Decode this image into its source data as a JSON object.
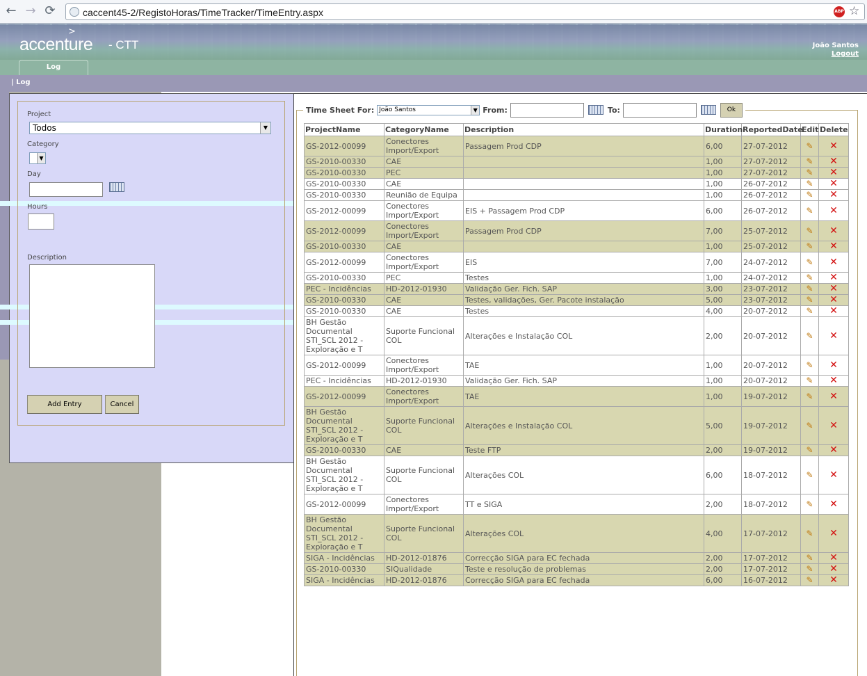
{
  "browser": {
    "url": "caccent45-2/RegistoHoras/TimeTracker/TimeEntry.aspx",
    "adblock_badge": "ABP"
  },
  "header": {
    "logo": "accenture",
    "logo_mark": ">",
    "suffix": "- CTT",
    "user": "João Santos",
    "logout": "Logout"
  },
  "tabs": [
    {
      "label": "Log"
    }
  ],
  "breadcrumb": "| Log",
  "form": {
    "project_label": "Project",
    "project_value": "Todos",
    "category_label": "Category",
    "day_label": "Day",
    "hours_label": "Hours",
    "description_label": "Description",
    "add_button": "Add Entry",
    "cancel_button": "Cancel"
  },
  "timesheet": {
    "for_label": "Time Sheet For:",
    "user_value": "João Santos",
    "from_label": "From:",
    "to_label": "To:",
    "ok_button": "Ok",
    "columns": [
      "ProjectName",
      "CategoryName",
      "Description",
      "Duration",
      "ReportedDate",
      "Edit",
      "Delete"
    ],
    "rows": [
      {
        "project": "GS-2012-00099",
        "category": "Conectores Import/Export",
        "description": "Passagem Prod CDP",
        "duration": "6,00",
        "date": "27-07-2012",
        "hl": true
      },
      {
        "project": "GS-2010-00330",
        "category": "CAE",
        "description": "",
        "duration": "1,00",
        "date": "27-07-2012",
        "hl": true
      },
      {
        "project": "GS-2010-00330",
        "category": "PEC",
        "description": "",
        "duration": "1,00",
        "date": "27-07-2012",
        "hl": true
      },
      {
        "project": "GS-2010-00330",
        "category": "CAE",
        "description": "",
        "duration": "1,00",
        "date": "26-07-2012",
        "hl": false
      },
      {
        "project": "GS-2010-00330",
        "category": "Reunião de Equipa",
        "description": "",
        "duration": "1,00",
        "date": "26-07-2012",
        "hl": false
      },
      {
        "project": "GS-2012-00099",
        "category": "Conectores Import/Export",
        "description": "EIS + Passagem Prod CDP",
        "duration": "6,00",
        "date": "26-07-2012",
        "hl": false
      },
      {
        "project": "GS-2012-00099",
        "category": "Conectores Import/Export",
        "description": "Passagem Prod CDP",
        "duration": "7,00",
        "date": "25-07-2012",
        "hl": true
      },
      {
        "project": "GS-2010-00330",
        "category": "CAE",
        "description": "",
        "duration": "1,00",
        "date": "25-07-2012",
        "hl": true
      },
      {
        "project": "GS-2012-00099",
        "category": "Conectores Import/Export",
        "description": "EIS",
        "duration": "7,00",
        "date": "24-07-2012",
        "hl": false
      },
      {
        "project": "GS-2010-00330",
        "category": "PEC",
        "description": "Testes",
        "duration": "1,00",
        "date": "24-07-2012",
        "hl": false
      },
      {
        "project": "PEC - Incidências",
        "category": "HD-2012-01930",
        "description": "Validação Ger. Fich. SAP",
        "duration": "3,00",
        "date": "23-07-2012",
        "hl": true
      },
      {
        "project": "GS-2010-00330",
        "category": "CAE",
        "description": "Testes, validações, Ger. Pacote instalação",
        "duration": "5,00",
        "date": "23-07-2012",
        "hl": true
      },
      {
        "project": "GS-2010-00330",
        "category": "CAE",
        "description": "Testes",
        "duration": "4,00",
        "date": "20-07-2012",
        "hl": false
      },
      {
        "project": "BH Gestão Documental STI_SCL 2012 - Exploração e T",
        "category": "Suporte Funcional COL",
        "description": "Alterações e Instalação COL",
        "duration": "2,00",
        "date": "20-07-2012",
        "hl": false
      },
      {
        "project": "GS-2012-00099",
        "category": "Conectores Import/Export",
        "description": "TAE",
        "duration": "1,00",
        "date": "20-07-2012",
        "hl": false
      },
      {
        "project": "PEC - Incidências",
        "category": "HD-2012-01930",
        "description": "Validação Ger. Fich. SAP",
        "duration": "1,00",
        "date": "20-07-2012",
        "hl": false
      },
      {
        "project": "GS-2012-00099",
        "category": "Conectores Import/Export",
        "description": "TAE",
        "duration": "1,00",
        "date": "19-07-2012",
        "hl": true
      },
      {
        "project": "BH Gestão Documental STI_SCL 2012 - Exploração e T",
        "category": "Suporte Funcional COL",
        "description": "Alterações e Instalação COL",
        "duration": "5,00",
        "date": "19-07-2012",
        "hl": true
      },
      {
        "project": "GS-2010-00330",
        "category": "CAE",
        "description": "Teste FTP",
        "duration": "2,00",
        "date": "19-07-2012",
        "hl": true
      },
      {
        "project": "BH Gestão Documental STI_SCL 2012 - Exploração e T",
        "category": "Suporte Funcional COL",
        "description": "Alterações COL",
        "duration": "6,00",
        "date": "18-07-2012",
        "hl": false
      },
      {
        "project": "GS-2012-00099",
        "category": "Conectores Import/Export",
        "description": "TT e SIGA",
        "duration": "2,00",
        "date": "18-07-2012",
        "hl": false
      },
      {
        "project": "BH Gestão Documental STI_SCL 2012 - Exploração e T",
        "category": "Suporte Funcional COL",
        "description": "Alterações COL",
        "duration": "4,00",
        "date": "17-07-2012",
        "hl": true
      },
      {
        "project": "SIGA - Incidências",
        "category": "HD-2012-01876",
        "description": "Correcção SIGA para EC fechada",
        "duration": "2,00",
        "date": "17-07-2012",
        "hl": true
      },
      {
        "project": "GS-2010-00330",
        "category": "SIQualidade",
        "description": "Teste e resolução de problemas",
        "duration": "2,00",
        "date": "17-07-2012",
        "hl": true
      },
      {
        "project": "SIGA - Incidências",
        "category": "HD-2012-01876",
        "description": "Correcção SIGA para EC fechada",
        "duration": "6,00",
        "date": "16-07-2012",
        "hl": true
      }
    ]
  }
}
